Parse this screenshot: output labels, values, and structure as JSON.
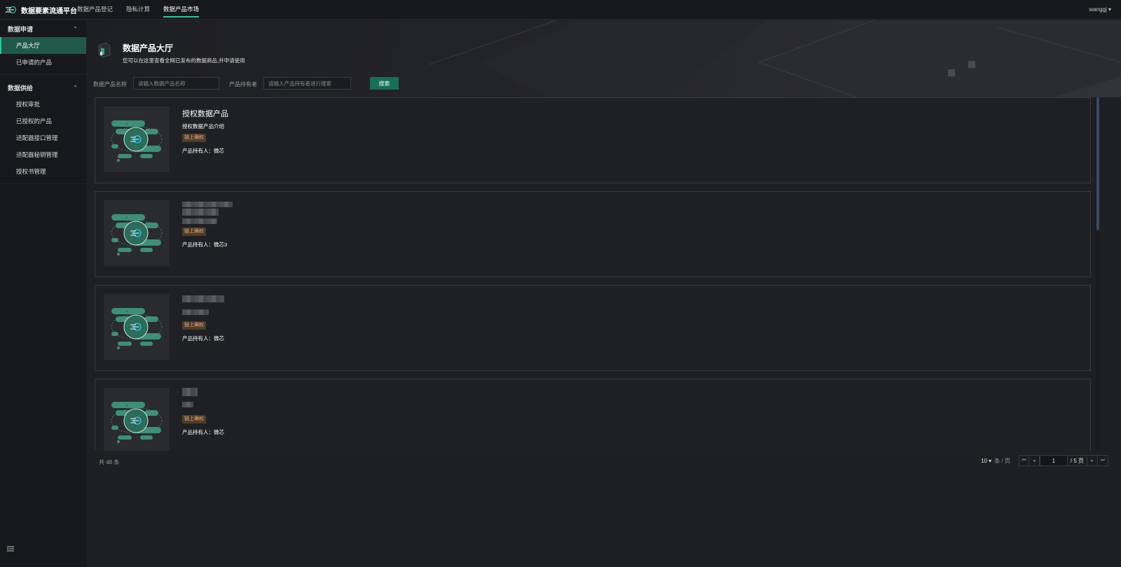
{
  "header": {
    "brand": "数据要素流通平台",
    "nav": [
      "数据产品登记",
      "隐私计算",
      "数据产品市场"
    ],
    "active_nav_index": 2,
    "user": "wanggj ▾"
  },
  "sidebar": {
    "groups": [
      {
        "label": "数据申请",
        "items": [
          "产品大厅",
          "已申请的产品"
        ]
      },
      {
        "label": "数据供给",
        "items": [
          "授权审批",
          "已授权的产品",
          "适配器接口管理",
          "适配器秘钥管理",
          "授权书管理"
        ]
      }
    ],
    "active_item": "产品大厅",
    "caret": "⌃"
  },
  "page": {
    "title": "数据产品大厅",
    "subtitle": "您可以在这里查看全网已发布的数据商品,并申请使用"
  },
  "filters": {
    "name_label": "数据产品名称",
    "name_placeholder": "请输入数据产品名称",
    "owner_label": "产品持有者",
    "owner_placeholder": "请输入产品持有者进行搜索",
    "search_button": "搜索"
  },
  "products": [
    {
      "title": "授权数据产品",
      "desc": "授权数据产品介绍",
      "tag": "链上确权",
      "owner": "产品持有人：微芯",
      "title_redacted": false
    },
    {
      "title": "",
      "desc": "",
      "tag": "链上确权",
      "owner": "产品持有人：微芯3",
      "title_redacted": true
    },
    {
      "title": "",
      "desc": "",
      "tag": "链上确权",
      "owner": "产品持有人：微芯",
      "title_redacted": true
    },
    {
      "title": "",
      "desc": "",
      "tag": "链上确权",
      "owner": "产品持有人：微芯",
      "title_redacted": true
    }
  ],
  "pagination": {
    "total_text": "共 48 条",
    "page_size": "10 ▾",
    "page_size_unit": "条 / 页",
    "current_page": "1",
    "total_pages_text": "/ 5 页",
    "first_icon": "⏮",
    "prev_icon": "◂",
    "next_icon": "▸",
    "last_icon": "⏭"
  },
  "colors": {
    "accent": "#2ec4a0",
    "active_bg": "#1f5a48",
    "tag_bg": "#4d3d2d",
    "tag_text": "#e9a96a",
    "background": "#1e1f23"
  }
}
